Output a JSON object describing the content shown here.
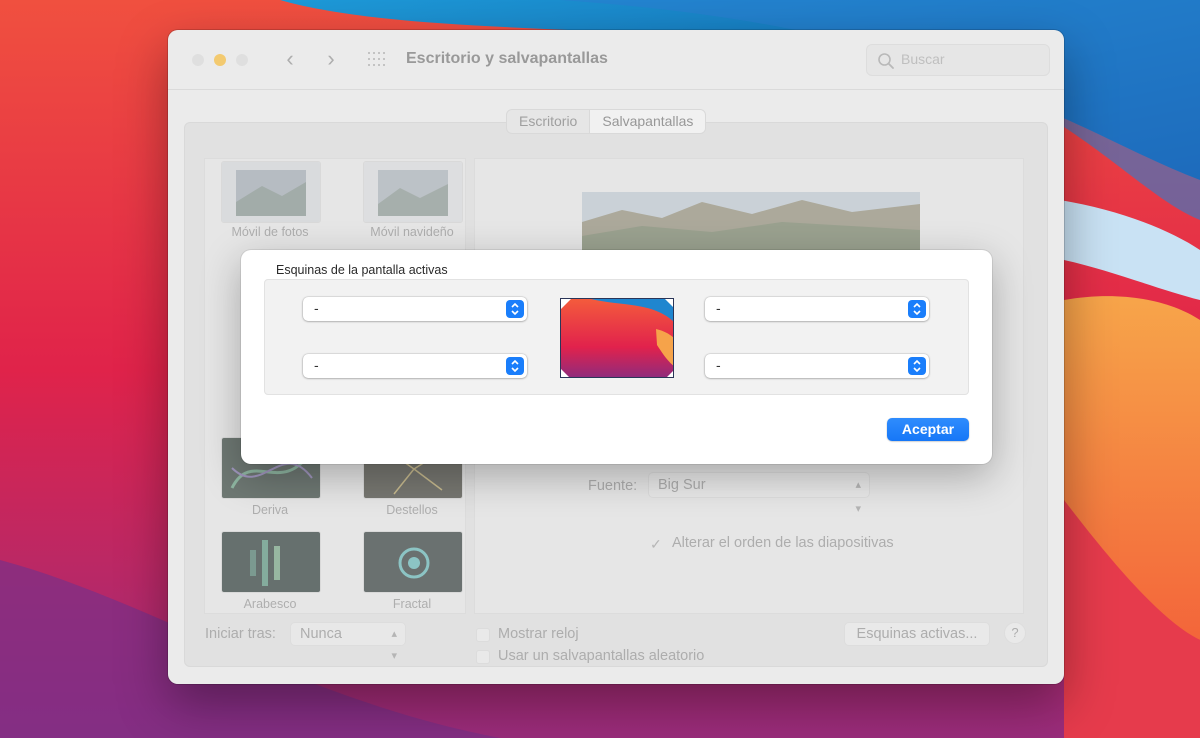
{
  "window": {
    "title": "Escritorio y salvapantallas",
    "search_placeholder": "Buscar"
  },
  "tabs": [
    {
      "label": "Escritorio",
      "active": false
    },
    {
      "label": "Salvapantallas",
      "active": true
    }
  ],
  "screensavers": [
    {
      "label": "Móvil de fotos"
    },
    {
      "label": "Móvil navideño"
    },
    {
      "label": "Deriva"
    },
    {
      "label": "Destellos"
    },
    {
      "label": "Arabesco"
    },
    {
      "label": "Fractal"
    }
  ],
  "options": {
    "source_label": "Fuente:",
    "source_value": "Big Sur",
    "shuffle_label": "Alterar el orden de las diapositivas",
    "shuffle_checked": true
  },
  "footer": {
    "start_after_label": "Iniciar tras:",
    "start_after_value": "Nunca",
    "show_clock_label": "Mostrar reloj",
    "random_label": "Usar un salvapantallas aleatorio",
    "hot_corners_button": "Esquinas activas...",
    "help_button": "?"
  },
  "sheet": {
    "title": "Esquinas de la pantalla activas",
    "top_left": "-",
    "top_right": "-",
    "bottom_left": "-",
    "bottom_right": "-",
    "accept_button": "Aceptar"
  },
  "colors": {
    "accent": "#1a7efb",
    "minimize": "#f7b82e"
  }
}
